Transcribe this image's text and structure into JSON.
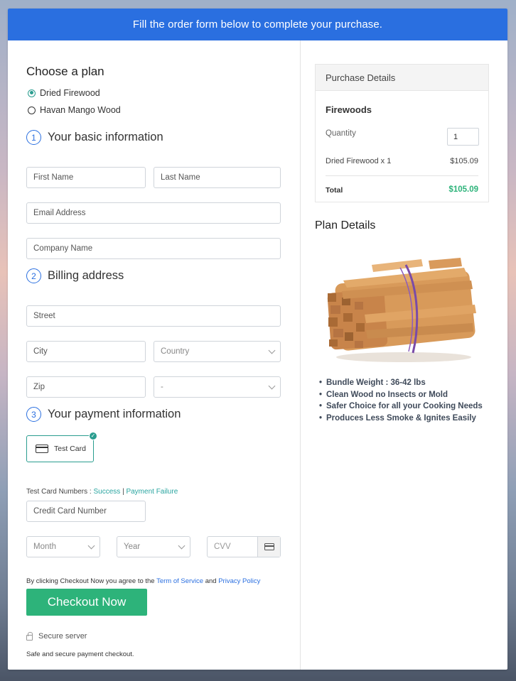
{
  "banner": "Fill the order form below to complete your purchase.",
  "plan": {
    "title": "Choose a plan",
    "options": [
      {
        "label": "Dried Firewood",
        "selected": true
      },
      {
        "label": "Havan Mango Wood",
        "selected": false
      }
    ]
  },
  "basic": {
    "num": "1",
    "title": "Your basic information",
    "first_name": "First Name",
    "last_name": "Last Name",
    "email": "Email Address",
    "company": "Company Name"
  },
  "billing": {
    "num": "2",
    "title": "Billing address",
    "street": "Street",
    "city": "City",
    "country": "Country",
    "zip": "Zip",
    "state": "-"
  },
  "payment": {
    "num": "3",
    "title": "Your payment information",
    "test_card": "Test Card",
    "test_numbers_label": "Test Card Numbers : ",
    "success": "Success",
    "separator": "|",
    "failure": "Payment Failure",
    "card_number": "Credit Card Number",
    "month": "Month",
    "year": "Year",
    "cvv": "CVV"
  },
  "agree": {
    "prefix": "By clicking Checkout Now you agree to the ",
    "terms": "Term of Service",
    "and": " and ",
    "privacy": "Privacy Policy"
  },
  "checkout_label": "Checkout Now",
  "secure_server": "Secure server",
  "secure_note": "Safe and secure payment checkout.",
  "purchase": {
    "title": "Purchase Details",
    "product": "Firewoods",
    "quantity_label": "Quantity",
    "quantity_value": "1",
    "item": "Dried Firewood x 1",
    "item_price": "$105.09",
    "total_label": "Total",
    "total_value": "$105.09"
  },
  "plan_details": {
    "title": "Plan Details",
    "bullets": [
      "Bundle Weight : 36-42 lbs",
      "Clean Wood no Insects or Mold",
      "Safer Choice for all your Cooking Needs",
      "Produces Less Smoke & Ignites Easily"
    ]
  },
  "colors": {
    "banner": "#2a6fe0",
    "accent": "#2a9d8f",
    "checkout": "#2db37a",
    "total": "#2db37a"
  },
  "icons": [
    "card-icon",
    "lock-icon",
    "chevron-down-icon",
    "check-icon"
  ]
}
